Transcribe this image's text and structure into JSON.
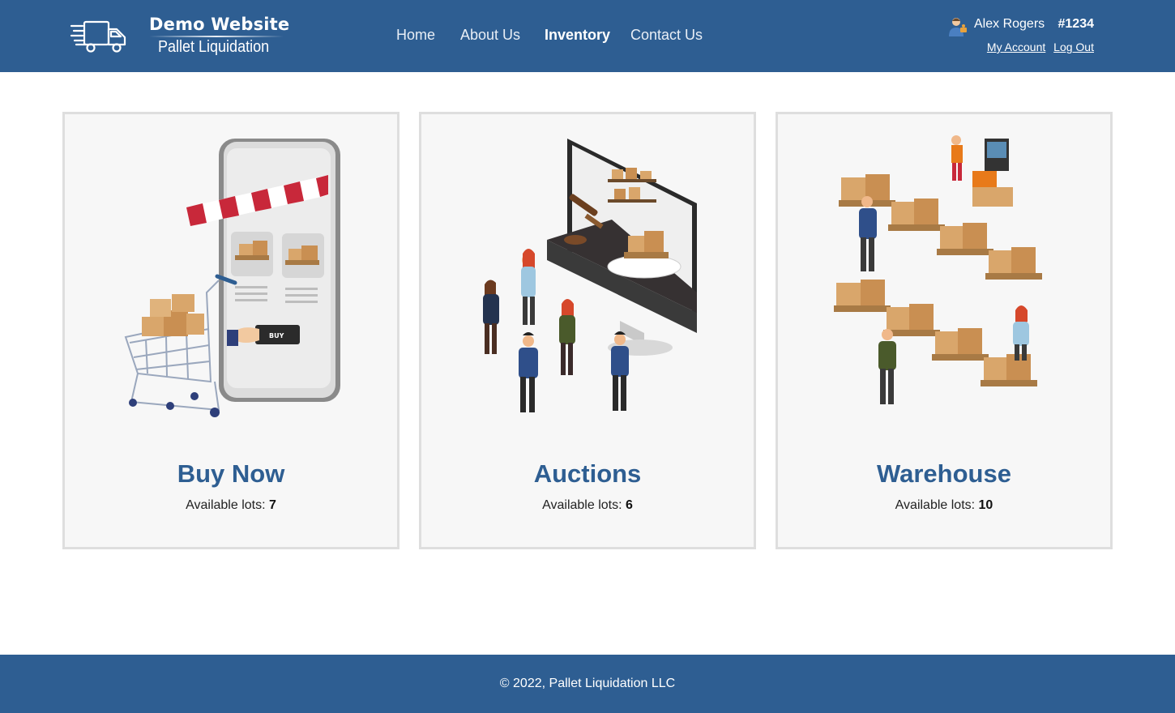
{
  "brand": {
    "title": "Demo Website",
    "subtitle": "Pallet Liquidation"
  },
  "nav": {
    "items": [
      {
        "label": "Home",
        "active": false
      },
      {
        "label": "About Us",
        "active": false
      },
      {
        "label": "Inventory",
        "active": true
      },
      {
        "label": "Contact Us",
        "active": false
      }
    ]
  },
  "user": {
    "name": "Alex Rogers",
    "id": "#1234",
    "my_account_label": "My Account",
    "logout_label": "Log Out",
    "avatar_icon": "user-avatar-icon"
  },
  "cards": [
    {
      "title": "Buy Now",
      "count_label": "Available lots:",
      "count": "7",
      "illustration": "shopping-cart-phone-illustration"
    },
    {
      "title": "Auctions",
      "count_label": "Available lots:",
      "count": "6",
      "illustration": "auction-monitor-illustration"
    },
    {
      "title": "Warehouse",
      "count_label": "Available lots:",
      "count": "10",
      "illustration": "warehouse-pallets-illustration"
    }
  ],
  "footer": {
    "text": "© 2022, Pallet Liquidation LLC"
  },
  "colors": {
    "brand_blue": "#2e5e92",
    "card_bg": "#f7f7f7",
    "card_border": "#dedede",
    "box_tan": "#d9a66b"
  }
}
